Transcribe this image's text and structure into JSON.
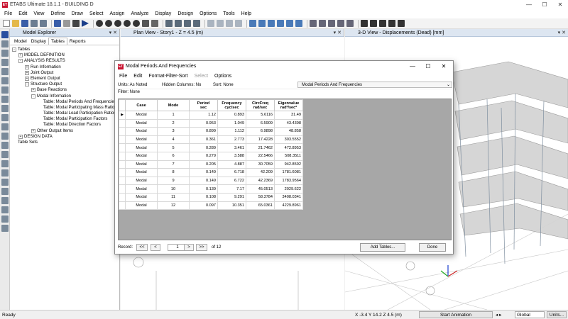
{
  "app": {
    "title": "ETABS Ultimate 18.1.1 - BUILDING D",
    "icon": "ET"
  },
  "menubar": [
    "File",
    "Edit",
    "View",
    "Define",
    "Draw",
    "Select",
    "Assign",
    "Analyze",
    "Display",
    "Design",
    "Options",
    "Tools",
    "Help"
  ],
  "explorer": {
    "title": "Model Explorer",
    "tabs": [
      "Model",
      "Display",
      "Tables",
      "Reports"
    ],
    "active_tab": "Tables",
    "tree": [
      {
        "level": 0,
        "toggle": "-",
        "label": "Tables"
      },
      {
        "level": 1,
        "toggle": "+",
        "label": "MODEL DEFINITION"
      },
      {
        "level": 1,
        "toggle": "-",
        "label": "ANALYSIS RESULTS"
      },
      {
        "level": 2,
        "toggle": "+",
        "label": "Run Information"
      },
      {
        "level": 2,
        "toggle": "+",
        "label": "Joint Output"
      },
      {
        "level": 2,
        "toggle": "+",
        "label": "Element Output"
      },
      {
        "level": 2,
        "toggle": "-",
        "label": "Structure Output"
      },
      {
        "level": 3,
        "toggle": "+",
        "label": "Base Reactions"
      },
      {
        "level": 3,
        "toggle": "-",
        "label": "Modal Information"
      },
      {
        "level": 4,
        "toggle": "",
        "label": "Table:  Modal Periods And Frequencies"
      },
      {
        "level": 4,
        "toggle": "",
        "label": "Table:  Modal Participating Mass Ratios"
      },
      {
        "level": 4,
        "toggle": "",
        "label": "Table:  Modal Load Participation Ratios"
      },
      {
        "level": 4,
        "toggle": "",
        "label": "Table:  Modal Participation Factors"
      },
      {
        "level": 4,
        "toggle": "",
        "label": "Table:  Modal Direction Factors"
      },
      {
        "level": 3,
        "toggle": "+",
        "label": "Other Output Items"
      },
      {
        "level": 1,
        "toggle": "+",
        "label": "DESIGN DATA"
      },
      {
        "level": 0,
        "toggle": "",
        "label": "Table Sets"
      }
    ]
  },
  "planview": {
    "title": "Plan View - Story1 - Z = 4.5 (m)"
  },
  "view3d": {
    "title": "3-D View  - Displacements (Dead)  [mm]"
  },
  "dialog": {
    "title": "Modal Periods And Frequencies",
    "icon": "ET",
    "menu": [
      "File",
      "Edit",
      "Format-Filter-Sort",
      "Select",
      "Options"
    ],
    "units_label": "Units:  As Noted",
    "hidden_label": "Hidden Columns:  No",
    "sort_label": "Sort:  None",
    "table_select": "Modal Periods And Frequencies",
    "filter_label": "Filter:  None",
    "columns": [
      {
        "line1": "Case",
        "line2": ""
      },
      {
        "line1": "Mode",
        "line2": ""
      },
      {
        "line1": "Period",
        "line2": "sec"
      },
      {
        "line1": "Frequency",
        "line2": "cyc/sec"
      },
      {
        "line1": "CircFreq",
        "line2": "rad/sec"
      },
      {
        "line1": "Eigenvalue",
        "line2": "rad²/sec²"
      }
    ],
    "rows": [
      [
        "Modal",
        "1",
        "1.12",
        "0.893",
        "5.6116",
        "31.49"
      ],
      [
        "Modal",
        "2",
        "0.953",
        "1.049",
        "6.5909",
        "43.4398"
      ],
      [
        "Modal",
        "3",
        "0.899",
        "1.112",
        "6.9898",
        "48.858"
      ],
      [
        "Modal",
        "4",
        "0.361",
        "2.773",
        "17.4228",
        "303.5552"
      ],
      [
        "Modal",
        "5",
        "0.289",
        "3.461",
        "21.7462",
        "472.8953"
      ],
      [
        "Modal",
        "6",
        "0.279",
        "3.588",
        "22.5466",
        "508.3511"
      ],
      [
        "Modal",
        "7",
        "0.205",
        "4.887",
        "30.7059",
        "942.8592"
      ],
      [
        "Modal",
        "8",
        "0.149",
        "6.718",
        "42.209",
        "1781.6081"
      ],
      [
        "Modal",
        "9",
        "0.149",
        "6.722",
        "42.2369",
        "1783.9564"
      ],
      [
        "Modal",
        "10",
        "0.139",
        "7.17",
        "45.0513",
        "2029.622"
      ],
      [
        "Modal",
        "11",
        "0.108",
        "9.291",
        "58.3784",
        "3408.0341"
      ],
      [
        "Modal",
        "12",
        "0.097",
        "10.351",
        "65.0361",
        "4229.8961"
      ]
    ],
    "current_row_marker": "▶",
    "footer": {
      "record_label": "Record:",
      "first": "<<",
      "prev": "<",
      "record_value": "1",
      "next": ">",
      "last": ">>",
      "of_label": "of 12",
      "add_tables": "Add Tables...",
      "done": "Done"
    }
  },
  "statusbar": {
    "ready": "Ready",
    "coords": "X -3.4  Y 14.2  Z 4.5 (m)",
    "start_animation": "Start Animation",
    "arrows": "◂ ▸",
    "coord_system": "Global",
    "units": "Units..."
  }
}
